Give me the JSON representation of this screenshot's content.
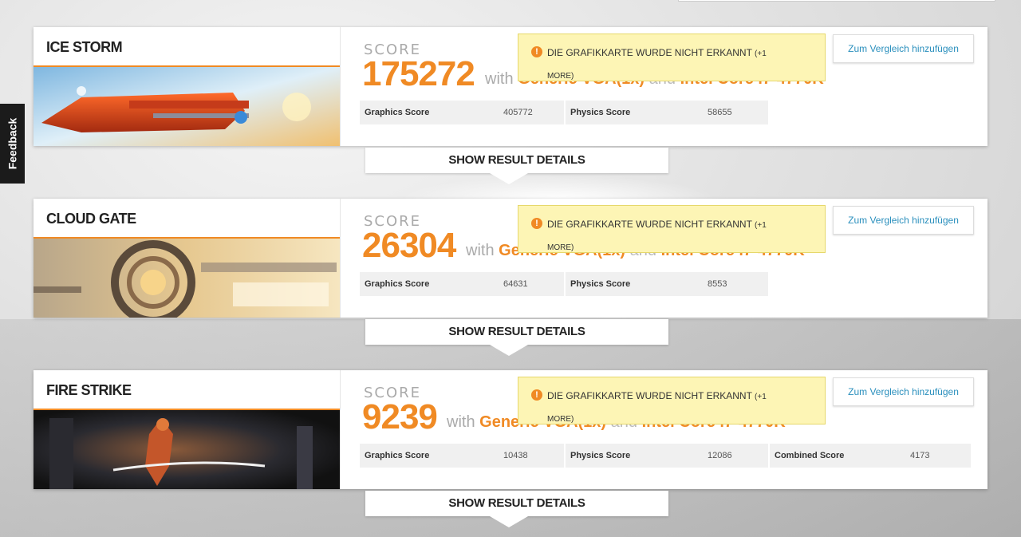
{
  "feedback": {
    "label": "Feedback"
  },
  "benchmarks": [
    {
      "name": "ICE STORM",
      "score_label": "SCORE",
      "score": "175272",
      "with": "with",
      "gpu": "Generic VGA(1x)",
      "and": "and",
      "cpu": "Intel Core i7-4770K",
      "subscores": [
        {
          "label": "Graphics Score",
          "value": "405772"
        },
        {
          "label": "Physics Score",
          "value": "58655"
        }
      ],
      "warning": {
        "text": "DIE GRAFIKKARTE WURDE NICHT ERKANNT",
        "more": "(+1",
        "more2": "MORE)"
      },
      "compare_label": "Zum Vergleich hinzufügen",
      "details_label": "SHOW RESULT DETAILS"
    },
    {
      "name": "CLOUD GATE",
      "score_label": "SCORE",
      "score": "26304",
      "with": "with",
      "gpu": "Generic VGA(1x)",
      "and": "and",
      "cpu": "Intel Core i7-4770K",
      "subscores": [
        {
          "label": "Graphics Score",
          "value": "64631"
        },
        {
          "label": "Physics Score",
          "value": "8553"
        }
      ],
      "warning": {
        "text": "DIE GRAFIKKARTE WURDE NICHT ERKANNT",
        "more": "(+1",
        "more2": "MORE)"
      },
      "compare_label": "Zum Vergleich hinzufügen",
      "details_label": "SHOW RESULT DETAILS"
    },
    {
      "name": "FIRE STRIKE",
      "score_label": "SCORE",
      "score": "9239",
      "with": "with",
      "gpu": "Generic VGA(1x)",
      "and": "and",
      "cpu": "Intel Core i7-4770K",
      "subscores": [
        {
          "label": "Graphics Score",
          "value": "10438"
        },
        {
          "label": "Physics Score",
          "value": "12086"
        },
        {
          "label": "Combined Score",
          "value": "4173"
        }
      ],
      "warning": {
        "text": "DIE GRAFIKKARTE WURDE NICHT ERKANNT",
        "more": "(+1",
        "more2": "MORE)"
      },
      "compare_label": "Zum Vergleich hinzufügen",
      "details_label": "SHOW RESULT DETAILS"
    }
  ],
  "colors": {
    "accent": "#f08a24",
    "link": "#2a8fbd",
    "warning_bg": "#fdf5b5"
  }
}
